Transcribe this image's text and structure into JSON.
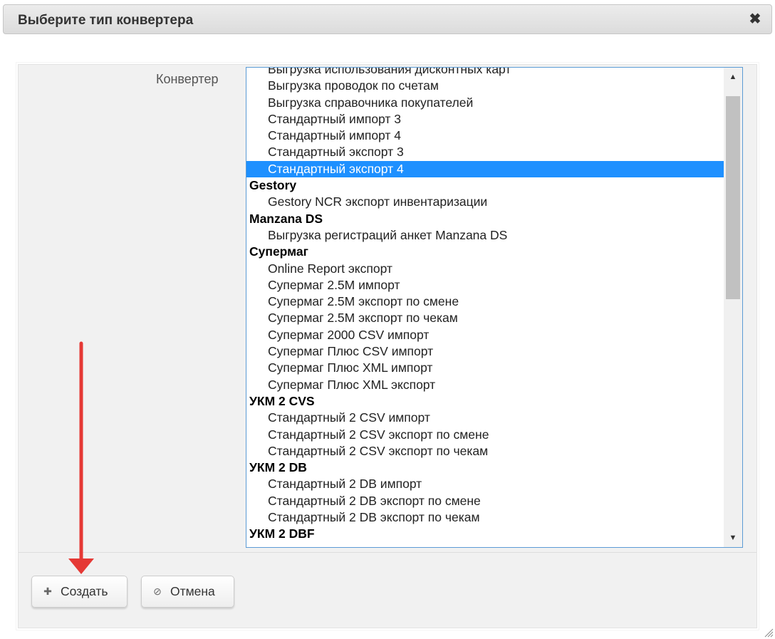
{
  "dialog": {
    "title": "Выберите тип конвертера",
    "close_symbol": "✖"
  },
  "form": {
    "converter_label": "Конвертер"
  },
  "list": {
    "partial_top_item": "Выгрузка использования дисконтных карт",
    "items_group1": [
      "Выгрузка проводок по счетам",
      "Выгрузка справочника покупателей",
      "Стандартный импорт 3",
      "Стандартный импорт 4",
      "Стандартный экспорт 3"
    ],
    "selected_item": "Стандартный экспорт 4",
    "group_gestory": "Gestory",
    "gestory_items": [
      "Gestory NCR экспорт инвентаризации"
    ],
    "group_manzana": "Manzana DS",
    "manzana_items": [
      "Выгрузка регистраций анкет Manzana DS"
    ],
    "group_supermag": "Супермаг",
    "supermag_items": [
      "Online Report экспорт",
      "Супермаг 2.5M импорт",
      "Супермаг 2.5M экспорт по смене",
      "Супермаг 2.5M экспорт по чекам",
      "Супермаг 2000 CSV импорт",
      "Супермаг Плюс CSV импорт",
      "Супермаг Плюс XML импорт",
      "Супермаг Плюс XML экспорт"
    ],
    "group_ukm2cvs": "УКМ 2 CVS",
    "ukm2cvs_items": [
      "Стандартный 2 CSV импорт",
      "Стандартный 2 CSV экспорт по смене",
      "Стандартный 2 CSV экспорт по чекам"
    ],
    "group_ukm2db": "УКМ 2 DB",
    "ukm2db_items": [
      "Стандартный 2 DB импорт",
      "Стандартный 2 DB экспорт по смене",
      "Стандартный 2 DB экспорт по чекам"
    ],
    "group_ukm2dbf": "УКМ 2 DBF"
  },
  "buttons": {
    "create_label": "Создать",
    "create_icon": "plus-icon",
    "cancel_label": "Отмена",
    "cancel_icon": "ban-icon"
  },
  "colors": {
    "selection": "#1e90ff",
    "annotation_arrow": "#e53935",
    "listbox_border": "#5b9bd5"
  }
}
